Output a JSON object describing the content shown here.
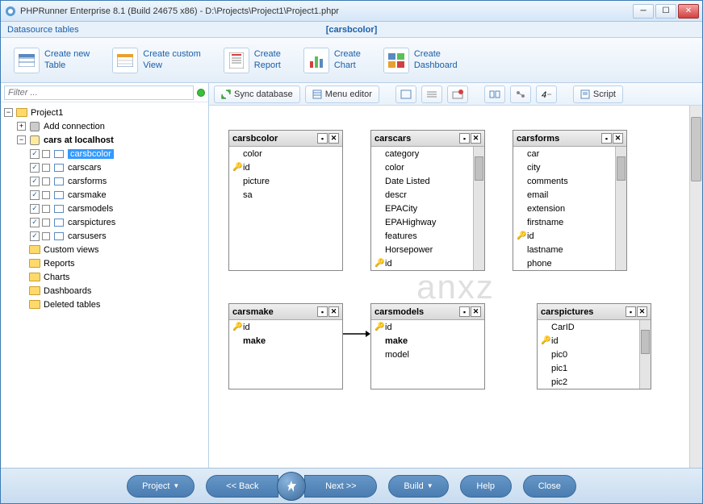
{
  "window": {
    "title": "PHPRunner Enterprise 8.1 (Build 24675 x86) - D:\\Projects\\Project1\\Project1.phpr"
  },
  "subheader": {
    "left": "Datasource tables",
    "center": "[carsbcolor]"
  },
  "topbar": {
    "items": [
      {
        "label": "Create new\nTable"
      },
      {
        "label": "Create custom\nView"
      },
      {
        "label": "Create\nReport"
      },
      {
        "label": "Create\nChart"
      },
      {
        "label": "Create\nDashboard"
      }
    ]
  },
  "filter": {
    "placeholder": "Filter ..."
  },
  "tree": {
    "root": "Project1",
    "addConn": "Add connection",
    "db": "cars at localhost",
    "tables": [
      "carsbcolor",
      "carscars",
      "carsforms",
      "carsmake",
      "carsmodels",
      "carspictures",
      "carsusers"
    ],
    "selected": "carsbcolor",
    "folders": [
      "Custom views",
      "Reports",
      "Charts",
      "Dashboards",
      "Deleted tables"
    ]
  },
  "toolbar": {
    "sync": "Sync database",
    "menu": "Menu editor",
    "script": "Script"
  },
  "diagram": {
    "r1": [
      {
        "name": "carsbcolor",
        "scroll": false,
        "fields": [
          {
            "n": "color"
          },
          {
            "n": "id",
            "key": true
          },
          {
            "n": "picture"
          },
          {
            "n": "sa"
          }
        ]
      },
      {
        "name": "carscars",
        "scroll": true,
        "fields": [
          {
            "n": "category"
          },
          {
            "n": "color"
          },
          {
            "n": "Date Listed"
          },
          {
            "n": "descr"
          },
          {
            "n": "EPACity"
          },
          {
            "n": "EPAHighway"
          },
          {
            "n": "features"
          },
          {
            "n": "Horsepower"
          },
          {
            "n": "id",
            "key": true
          }
        ]
      },
      {
        "name": "carsforms",
        "scroll": true,
        "fields": [
          {
            "n": "car"
          },
          {
            "n": "city"
          },
          {
            "n": "comments"
          },
          {
            "n": "email"
          },
          {
            "n": "extension"
          },
          {
            "n": "firstname"
          },
          {
            "n": "id",
            "key": true
          },
          {
            "n": "lastname"
          },
          {
            "n": "phone"
          }
        ]
      }
    ],
    "r2": [
      {
        "name": "carsmake",
        "scroll": false,
        "fields": [
          {
            "n": "id",
            "key": true
          },
          {
            "n": "make",
            "bold": true
          }
        ]
      },
      {
        "name": "carsmodels",
        "scroll": false,
        "fields": [
          {
            "n": "id",
            "key": true
          },
          {
            "n": "make",
            "bold": true
          },
          {
            "n": "model"
          }
        ]
      },
      {
        "name": "carspictures",
        "scroll": true,
        "fields": [
          {
            "n": "CarID"
          },
          {
            "n": "id",
            "key": true
          },
          {
            "n": "pic0"
          },
          {
            "n": "pic1"
          },
          {
            "n": "pic2"
          }
        ]
      }
    ]
  },
  "footer": {
    "project": "Project",
    "back": "<<  Back",
    "next": "Next  >>",
    "build": "Build",
    "help": "Help",
    "close": "Close"
  },
  "watermark": "anxz"
}
